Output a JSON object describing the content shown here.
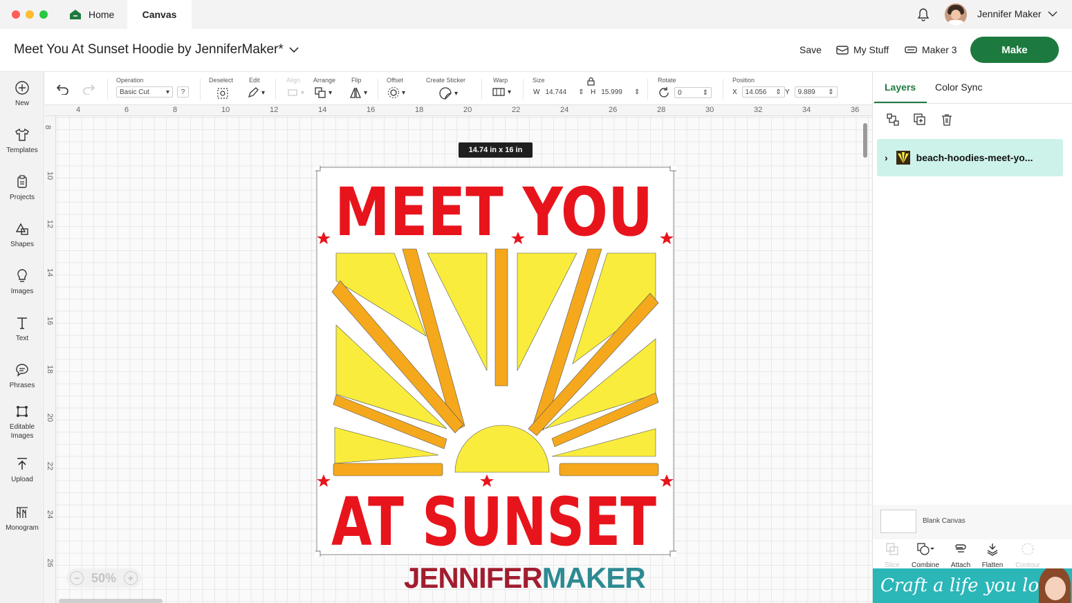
{
  "tabs": {
    "home": "Home",
    "canvas": "Canvas"
  },
  "user": {
    "name": "Jennifer Maker"
  },
  "project": {
    "title": "Meet You At Sunset Hoodie by JenniferMaker*"
  },
  "title_actions": {
    "save": "Save",
    "my_stuff": "My Stuff",
    "machine": "Maker 3",
    "make": "Make"
  },
  "sidebar": [
    {
      "label": "New",
      "icon": "plus-circle-icon"
    },
    {
      "label": "Templates",
      "icon": "shirt-icon"
    },
    {
      "label": "Projects",
      "icon": "clipboard-icon"
    },
    {
      "label": "Shapes",
      "icon": "shapes-icon"
    },
    {
      "label": "Images",
      "icon": "lightbulb-icon"
    },
    {
      "label": "Text",
      "icon": "text-icon"
    },
    {
      "label": "Phrases",
      "icon": "speech-bubble-icon"
    },
    {
      "label": "Editable Images",
      "icon": "editable-image-icon"
    },
    {
      "label": "Upload",
      "icon": "upload-icon"
    },
    {
      "label": "Monogram",
      "icon": "monogram-icon"
    }
  ],
  "toolbar": {
    "operation_label": "Operation",
    "operation_value": "Basic Cut",
    "help": "?",
    "deselect": "Deselect",
    "edit": "Edit",
    "align": "Align",
    "arrange": "Arrange",
    "flip": "Flip",
    "offset": "Offset",
    "create_sticker": "Create Sticker",
    "warp": "Warp",
    "size": "Size",
    "w_label": "W",
    "w_value": "14.744",
    "h_label": "H",
    "h_value": "15.999",
    "rotate": "Rotate",
    "rotate_value": "0",
    "position": "Position",
    "x_label": "X",
    "x_value": "14.056",
    "y_label": "Y",
    "y_value": "9.889"
  },
  "ruler": {
    "horizontal": [
      "4",
      "6",
      "8",
      "10",
      "12",
      "14",
      "16",
      "18",
      "20",
      "22",
      "24",
      "26",
      "28",
      "30",
      "32",
      "34",
      "36"
    ],
    "vertical": [
      "8",
      "10",
      "12",
      "14",
      "16",
      "18",
      "20",
      "22",
      "24",
      "26"
    ]
  },
  "canvas": {
    "size_badge": "14.74  in x 16  in",
    "design_line1": "MEET YOU",
    "design_line2": "AT SUNSET",
    "zoom": "50%",
    "watermark_part1": "JENNIFER",
    "watermark_part2": "MAKER"
  },
  "panel": {
    "tab_layers": "Layers",
    "tab_color_sync": "Color Sync",
    "layer_name": "beach-hoodies-meet-yo...",
    "blank_canvas": "Blank Canvas",
    "slice": "Slice",
    "combine": "Combine",
    "attach": "Attach",
    "flatten": "Flatten",
    "contour": "Contour",
    "banner": "Craft a life you love"
  },
  "colors": {
    "accent": "#1d7a3f",
    "design_red": "#e8141c",
    "sun_yellow": "#f9ec3c",
    "ray_orange": "#f5a81c",
    "selection": "#cdf2ea"
  }
}
